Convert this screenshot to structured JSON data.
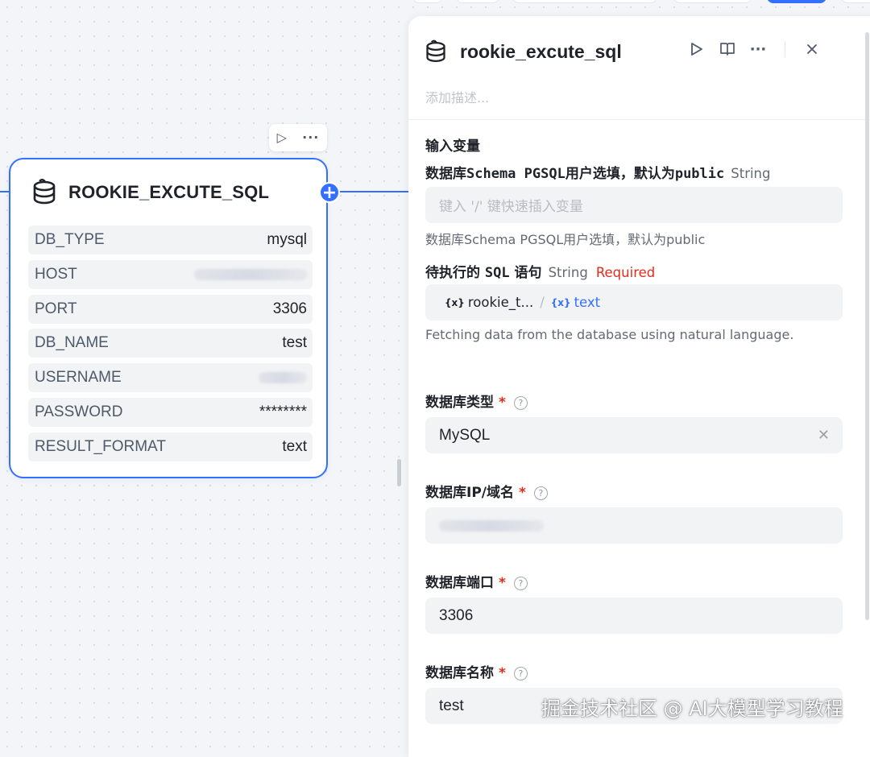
{
  "node": {
    "title": "ROOKIE_EXCUTE_SQL",
    "rows": [
      {
        "key": "DB_TYPE",
        "value": "mysql"
      },
      {
        "key": "HOST",
        "value": "20..."
      },
      {
        "key": "PORT",
        "value": "3306"
      },
      {
        "key": "DB_NAME",
        "value": "test"
      },
      {
        "key": "USERNAME",
        "value": "..."
      },
      {
        "key": "PASSWORD",
        "value": "********"
      },
      {
        "key": "RESULT_FORMAT",
        "value": "text"
      }
    ]
  },
  "panel": {
    "title": "rookie_excute_sql",
    "description_placeholder": "添加描述...",
    "section_title": "输入变量",
    "schema": {
      "label_prefix": "数据库",
      "label_mono": "Schema PGSQL",
      "label_suffix": "用户选填，默认为",
      "label_mono2": "public",
      "type": "String",
      "placeholder": "键入 '/' 键快速插入变量",
      "hint": "数据库Schema PGSQL用户选填，默认为public"
    },
    "sql": {
      "label_prefix": "待执行的 ",
      "label_mono": "SQL",
      "label_suffix": " 语句",
      "type": "String",
      "required": "Required",
      "var_node": "rookie_t...",
      "var_sep": "/",
      "var_field": "text",
      "hint": "Fetching data from the database using natural language."
    },
    "db_type": {
      "label": "数据库类型",
      "value": "MySQL"
    },
    "db_host": {
      "label": "数据库IP/域名",
      "value": "20..."
    },
    "db_port": {
      "label": "数据库端口",
      "value": "3306"
    },
    "db_name": {
      "label": "数据库名称",
      "value": "test"
    }
  },
  "watermark": "掘金技术社区 @ AI大模型学习教程",
  "colors": {
    "accent": "#3370ff",
    "required": "#e22c1b",
    "field_bg": "#f2f3f5"
  }
}
